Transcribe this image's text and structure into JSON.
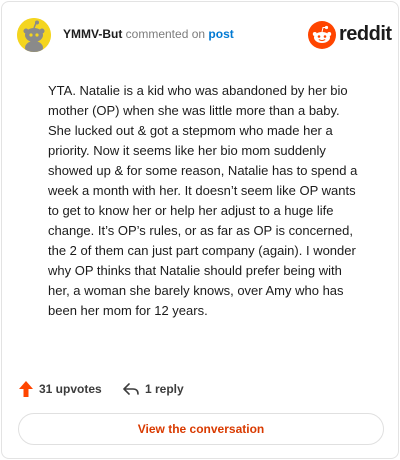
{
  "header": {
    "username": "YMMV-But",
    "action_text": "commented on",
    "post_link": "post",
    "brand": "reddit"
  },
  "comment": {
    "body": "YTA. Natalie is a kid who was abandoned by her bio mother (OP) when she was little more than a baby. She lucked out & got a stepmom who made her a priority. Now it seems like her bio mom suddenly showed up & for some reason, Natalie has to spend a week a month with her. It doesn’t seem like OP wants to get to know her or help her adjust to a huge life change. It’s OP’s rules, or as far as OP is concerned, the 2 of them can just part company (again). I wonder why OP thinks that Natalie should prefer being with her, a woman she barely knows, over Amy who has been her mom for 12 years."
  },
  "actions": {
    "upvotes": "31 upvotes",
    "replies": "1 reply"
  },
  "cta": {
    "label": "View the conversation"
  },
  "colors": {
    "brand_orange": "#ff4500",
    "link_blue": "#0079d3",
    "cta_text": "#d93a00",
    "avatar_bg": "#f4d51f"
  },
  "icons": {
    "avatar": "snoo-avatar-icon",
    "brand": "reddit-logo-icon",
    "upvote": "upvote-arrow-icon",
    "reply": "reply-arrow-icon"
  }
}
